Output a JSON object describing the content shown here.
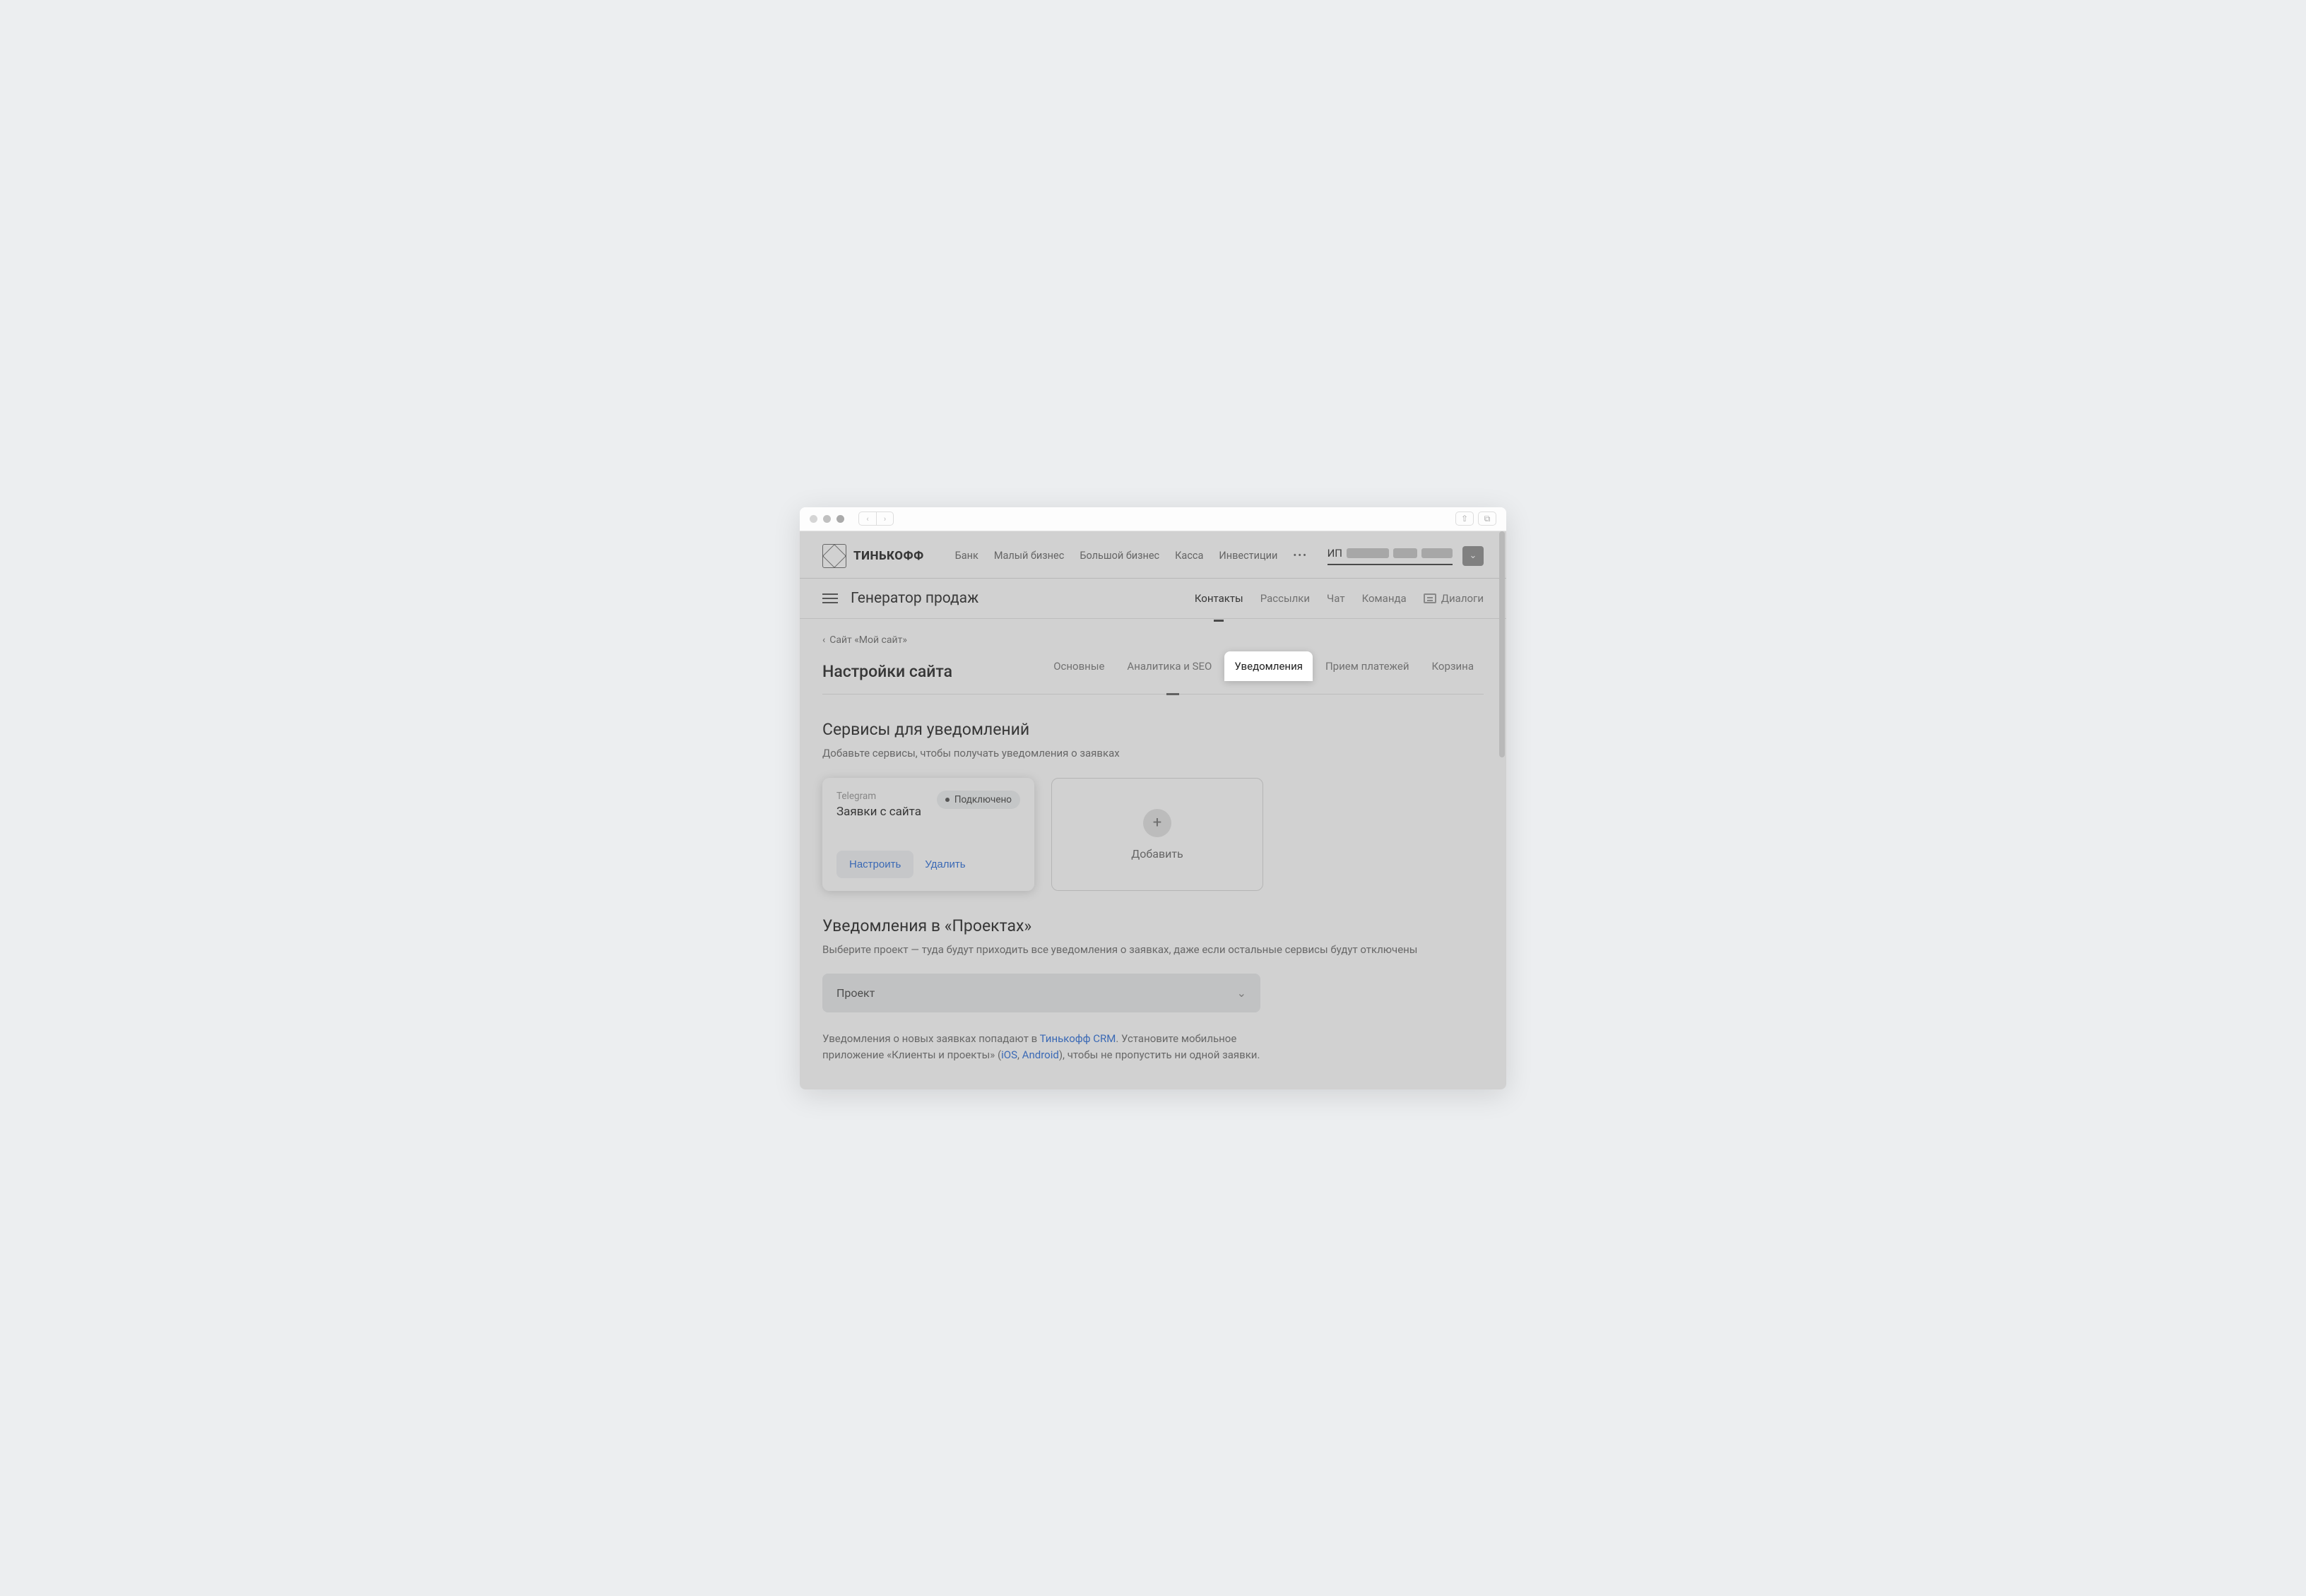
{
  "chrome": {
    "share_icon": "⇧",
    "tabs_icon": "⧉"
  },
  "topnav": {
    "brand": "ТИНЬКОФФ",
    "links": [
      "Банк",
      "Малый бизнес",
      "Большой бизнес",
      "Касса",
      "Инвестиции"
    ],
    "more": "•••",
    "account_prefix": "ИП"
  },
  "secnav": {
    "title": "Генератор продаж",
    "links": [
      "Контакты",
      "Рассылки",
      "Чат",
      "Команда"
    ],
    "active_index": 0,
    "dialogs": "Диалоги"
  },
  "breadcrumb": {
    "back_icon": "‹",
    "text": "Сайт «Мой сайт»"
  },
  "page_title": "Настройки сайта",
  "tabs": {
    "items": [
      "Основные",
      "Аналитика и SEO",
      "Уведомления",
      "Прием платежей",
      "Корзина"
    ],
    "active_index": 2
  },
  "section_services": {
    "heading": "Сервисы для уведомлений",
    "desc": "Добавьте сервисы, чтобы получать уведомления о заявках"
  },
  "telegram_card": {
    "label": "Telegram",
    "badge": "Подключено",
    "title": "Заявки с сайта",
    "configure": "Настроить",
    "delete": "Удалить"
  },
  "add_card": {
    "label": "Добавить"
  },
  "section_projects": {
    "heading": "Уведомления в «Проектах»",
    "desc": "Выберите проект — туда будут приходить все уведомления о заявках, даже если остальные сервисы будут отключены"
  },
  "select": {
    "label": "Проект"
  },
  "info": {
    "part1": "Уведомления о новых заявках попадают в ",
    "crm_link": "Тинькофф CRM",
    "part2": ". Установите мобильное приложение «Клиенты и проекты» (",
    "ios": "iOS",
    "sep": ", ",
    "android": "Android",
    "part3": "), чтобы не пропустить ни одной заявки."
  }
}
